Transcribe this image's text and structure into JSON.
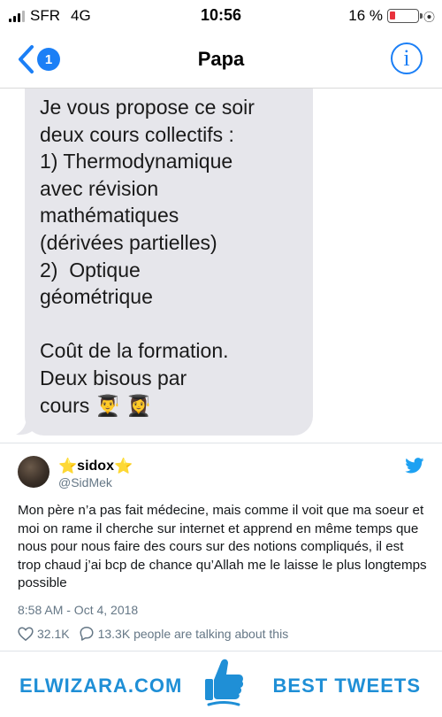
{
  "status_bar": {
    "carrier": "SFR",
    "network": "4G",
    "time": "10:56",
    "battery_percent": "16 %",
    "battery_level": 0.16,
    "colors": {
      "battery_low": "#e8323c"
    }
  },
  "nav": {
    "unread_badge": "1",
    "title": "Papa",
    "info_label": "i",
    "accent_color": "#1b7ff6",
    "icons": [
      "chevron-left-icon",
      "info-icon"
    ]
  },
  "message": {
    "text": "Je vous propose ce soir\ndeux cours collectifs :\n1) Thermodynamique\navec révision\nmathématiques\n(dérivées partielles)\n2)  Optique\ngéométrique\n\nCoût de la formation.\nDeux bisous par\ncours 👨‍🎓 👩‍🎓",
    "bubble_color": "#e6e6eb"
  },
  "tweet": {
    "display_name": "sidox",
    "name_decoration": "⭐",
    "handle": "@SidMek",
    "text": "Mon père n’a pas fait médecine, mais comme il voit que ma soeur et moi on rame il cherche sur internet et apprend en même temps que nous pour nous faire des cours sur des notions compliqués, il est trop chaud j’ai bcp de chance qu’Allah me le laisse le plus longtemps possible",
    "timestamp": "8:58 AM - Oct 4, 2018",
    "likes": "32.1K",
    "talking": "13.3K people are talking about this",
    "icons": [
      "twitter-bird-icon",
      "heart-icon",
      "comment-icon"
    ],
    "colors": {
      "twitter_blue": "#1da1f2",
      "meta_gray": "#657786"
    }
  },
  "footer": {
    "left_brand": "ELWIZARA.COM",
    "right_brand": "BEST TWEETS",
    "icon": "thumbs-up-icon",
    "brand_color": "#1f8fd6"
  }
}
